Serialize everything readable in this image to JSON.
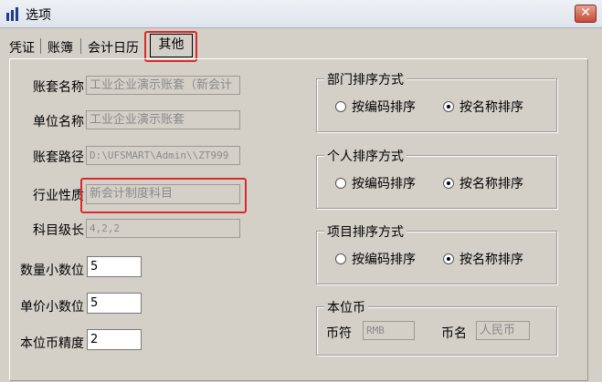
{
  "window": {
    "title": "选项",
    "close_glyph": "✕",
    "icon": "app-bars-icon"
  },
  "tabs": [
    "凭证",
    "账簿",
    "会计日历",
    "其他"
  ],
  "left": {
    "rows": [
      {
        "label": "账套名称",
        "value": "工业企业演示账套（新会计"
      },
      {
        "label": "单位名称",
        "value": "工业企业演示账套"
      },
      {
        "label": "账套路径",
        "value": "D:\\UFSMART\\Admin\\\\ZT999"
      },
      {
        "label": "行业性质",
        "value": "新会计制度科目"
      },
      {
        "label": "科目级长",
        "value": "4,2,2"
      }
    ],
    "edits": [
      {
        "label": "数量小数位",
        "value": "5"
      },
      {
        "label": "单价小数位",
        "value": "5"
      },
      {
        "label": "本位币精度",
        "value": "2"
      }
    ]
  },
  "groups": [
    {
      "title": "部门排序方式",
      "opt1": "按编码排序",
      "opt2": "按名称排序",
      "selected": 2
    },
    {
      "title": "个人排序方式",
      "opt1": "按编码排序",
      "opt2": "按名称排序",
      "selected": 2
    },
    {
      "title": "项目排序方式",
      "opt1": "按编码排序",
      "opt2": "按名称排序",
      "selected": 2
    }
  ],
  "currency": {
    "title": "本位币",
    "code_label": "币符",
    "code_value": "RMB",
    "name_label": "币名",
    "name_value": "人民币"
  },
  "colors": {
    "highlight": "#d92a2a",
    "background": "#d4d0c8"
  }
}
